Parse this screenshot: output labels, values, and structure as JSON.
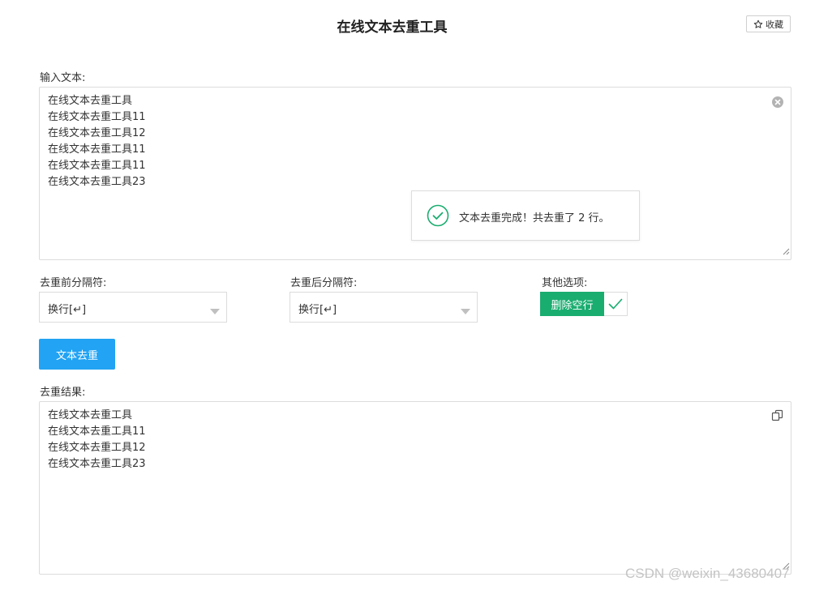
{
  "header": {
    "title": "在线文本去重工具",
    "favorite_label": "收藏"
  },
  "input": {
    "label": "输入文本:",
    "lines": [
      "在线文本去重工具",
      "在线文本去重工具11",
      "在线文本去重工具12",
      "在线文本去重工具11",
      "在线文本去重工具11",
      "在线文本去重工具23"
    ]
  },
  "toast": {
    "message": "文本去重完成！共去重了 2 行。",
    "icon": "check-circle-icon",
    "color": "#1aad70"
  },
  "options": {
    "before_separator": {
      "label": "去重前分隔符:",
      "value": "换行[↵]"
    },
    "after_separator": {
      "label": "去重后分隔符:",
      "value": "换行[↵]"
    },
    "other": {
      "label": "其他选项:",
      "toggle_label": "删除空行",
      "checked": true,
      "color": "#1aad70"
    }
  },
  "action": {
    "dedupe_label": "文本去重",
    "color": "#22a3f3"
  },
  "result": {
    "label": "去重结果:",
    "lines": [
      "在线文本去重工具",
      "在线文本去重工具11",
      "在线文本去重工具12",
      "在线文本去重工具23"
    ]
  },
  "watermark": "CSDN @weixin_43680407"
}
